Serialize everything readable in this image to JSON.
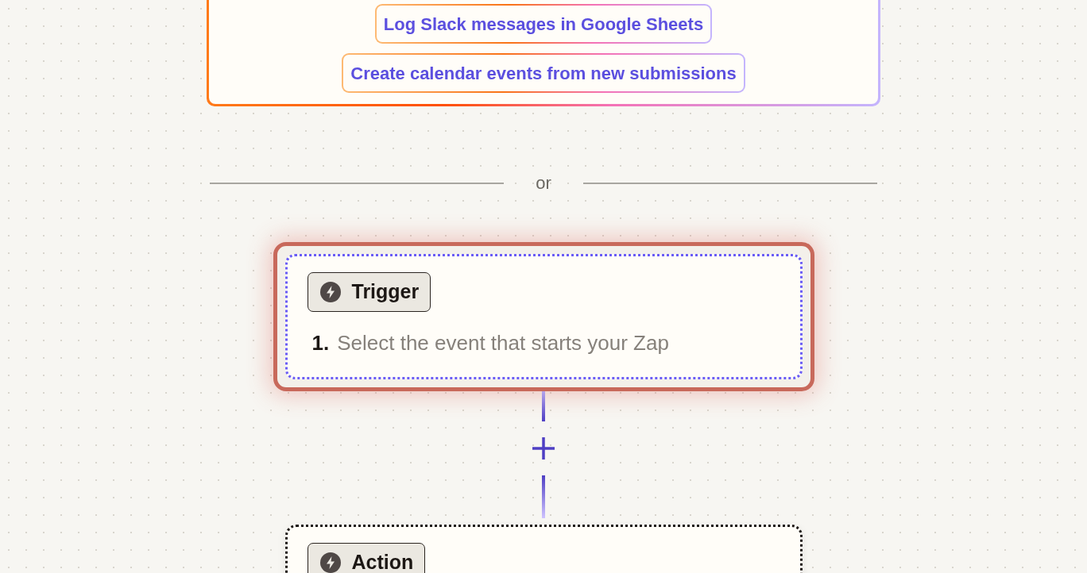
{
  "suggestions": [
    {
      "label": "Log Slack messages in Google Sheets"
    },
    {
      "label": "Create calendar events from new submissions"
    }
  ],
  "divider": {
    "label": "or"
  },
  "steps": [
    {
      "kind": "trigger",
      "label": "Trigger",
      "number": "1.",
      "text": "Select the event that starts your Zap",
      "selected": true
    },
    {
      "kind": "action",
      "label": "Action",
      "selected": false
    }
  ]
}
